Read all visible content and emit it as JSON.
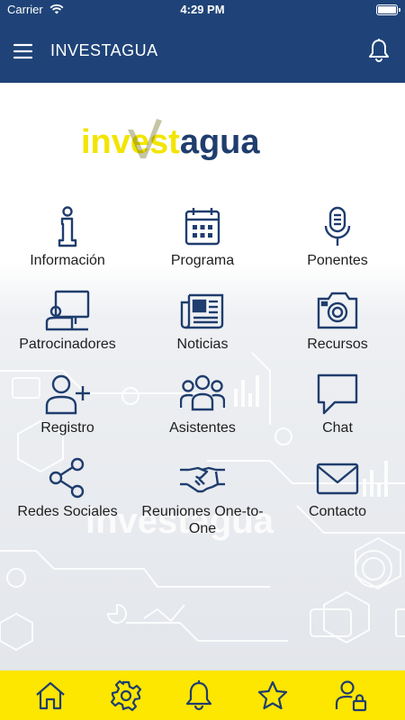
{
  "status_bar": {
    "carrier": "Carrier",
    "time": "4:29 PM"
  },
  "header": {
    "title": "INVESTAGUA",
    "menu_icon": "hamburger-menu-icon",
    "notifications_icon": "bell-icon"
  },
  "logo": {
    "text_part1": "inv",
    "text_part2": "est",
    "text_part3": "agua"
  },
  "menu": [
    {
      "label": "Información",
      "icon": "info-icon"
    },
    {
      "label": "Programa",
      "icon": "calendar-icon"
    },
    {
      "label": "Ponentes",
      "icon": "microphone-icon"
    },
    {
      "label": "Patrocinadores",
      "icon": "presenter-board-icon"
    },
    {
      "label": "Noticias",
      "icon": "newspaper-icon"
    },
    {
      "label": "Recursos",
      "icon": "camera-icon"
    },
    {
      "label": "Registro",
      "icon": "add-user-icon"
    },
    {
      "label": "Asistentes",
      "icon": "group-icon"
    },
    {
      "label": "Chat",
      "icon": "chat-bubble-icon"
    },
    {
      "label": "Redes Sociales",
      "icon": "share-icon"
    },
    {
      "label": "Reuniones One-to-One",
      "icon": "handshake-icon"
    },
    {
      "label": "Contacto",
      "icon": "envelope-icon"
    }
  ],
  "tab_bar": [
    "home-icon",
    "settings-gear-icon",
    "bell-icon",
    "star-icon",
    "user-lock-icon"
  ],
  "colors": {
    "primary": "#1f4378",
    "accent": "#fde600",
    "logo_yellow": "#f2e500",
    "logo_navy": "#1f3d6e"
  }
}
